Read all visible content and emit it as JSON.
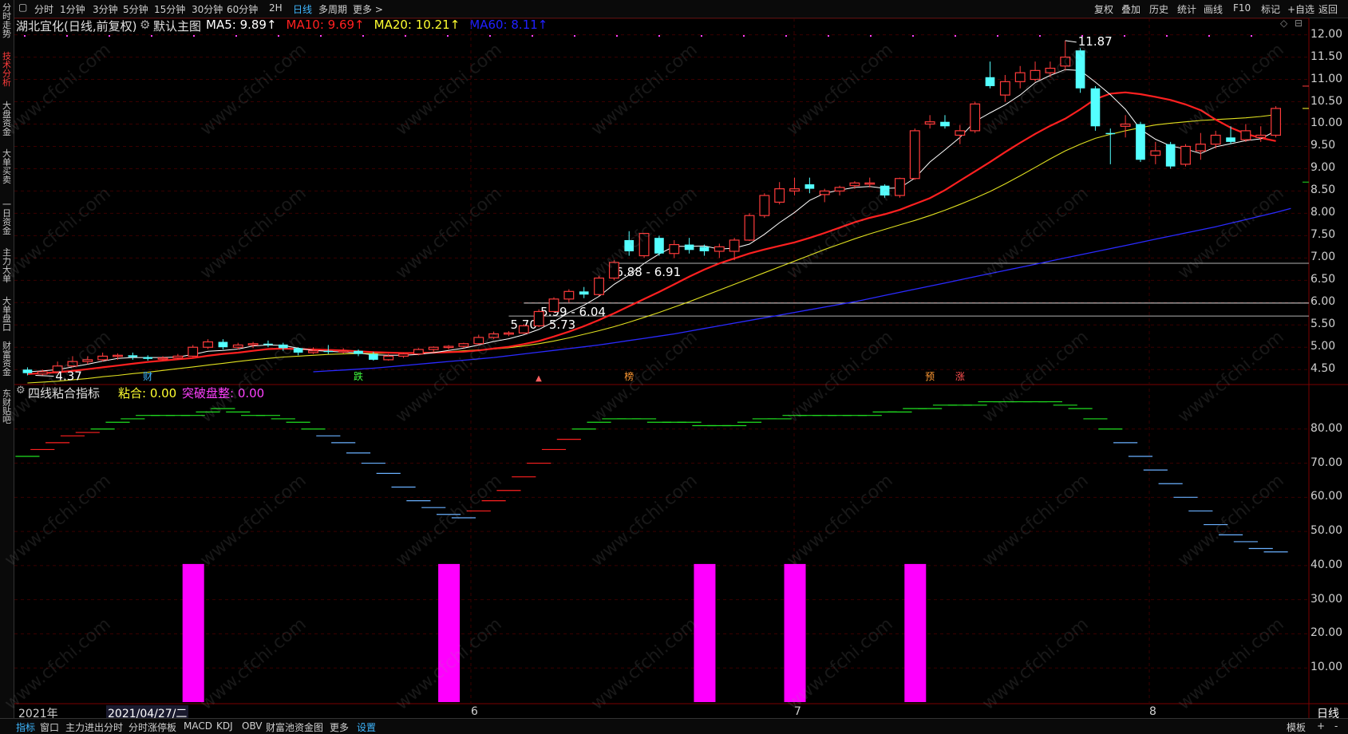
{
  "left_tabs": [
    {
      "label": "分时走势",
      "active": false
    },
    {
      "label": "技术分析",
      "active": true
    },
    {
      "label": "大盘资金",
      "active": false
    },
    {
      "label": "大单买卖",
      "active": false
    },
    {
      "label": "一日资金",
      "active": false
    },
    {
      "label": "主力大单",
      "active": false
    },
    {
      "label": "大单盘口",
      "active": false
    },
    {
      "label": "财富资金",
      "active": false
    },
    {
      "label": "东财贴吧",
      "active": false
    }
  ],
  "periods": [
    "分时",
    "1分钟",
    "3分钟",
    "5分钟",
    "15分钟",
    "30分钟",
    "60分钟",
    "2H",
    "日线",
    "多周期",
    "更多"
  ],
  "active_period": "日线",
  "toolbar": [
    "复权",
    "叠加",
    "历史",
    "统计",
    "画线",
    "F10",
    "标记",
    "+自选",
    "返回"
  ],
  "stock": {
    "title": "湖北宜化(日线,前复权)",
    "main_indicator": "默认主图"
  },
  "ma": [
    {
      "label": "MA5: 9.89",
      "arrow": "↑",
      "color": "#ffffff"
    },
    {
      "label": "MA10: 9.69",
      "arrow": "↑",
      "color": "#ff2020"
    },
    {
      "label": "MA20: 10.21",
      "arrow": "↑",
      "color": "#ffff30"
    },
    {
      "label": "MA60: 8.11",
      "arrow": "↑",
      "color": "#2020ff"
    }
  ],
  "price_axis": [
    "12.00",
    "11.50",
    "11.00",
    "10.50",
    "10.00",
    "9.50",
    "9.00",
    "8.50",
    "8.00",
    "7.50",
    "7.00",
    "6.50",
    "6.00",
    "5.50",
    "5.00",
    "4.50"
  ],
  "price_annotations": {
    "high": "11.87",
    "low": "4.37"
  },
  "ranges": [
    "6.88 - 6.91",
    "5.99 - 6.04",
    "5.70 - 5.73"
  ],
  "event_tags": [
    {
      "label": "财",
      "color": "#3fb7ff"
    },
    {
      "label": "跌",
      "color": "#40ff40"
    },
    {
      "label": "榜",
      "color": "#ff9933"
    },
    {
      "label": "预",
      "color": "#ff9933"
    },
    {
      "label": "涨",
      "color": "#ff5050"
    }
  ],
  "indicator": {
    "name": "四线粘合指标",
    "line1": "粘合: 0.00",
    "line2": "突破盘整: 0.00",
    "axis": [
      "80.00",
      "70.00",
      "60.00",
      "50.00",
      "40.00",
      "30.00",
      "20.00",
      "10.00"
    ]
  },
  "x_axis": {
    "year": "2021年",
    "cursor_date": "2021/04/27/二",
    "months": [
      "6",
      "7",
      "8"
    ],
    "period": "日线"
  },
  "bottom_tabs": [
    "指标",
    "窗口",
    "主力进出分时",
    "分时涨停板",
    "MACD",
    "KDJ",
    "OBV",
    "财富池资金图",
    "更多",
    "设置"
  ],
  "bottom_active": [
    "指标",
    "设置"
  ],
  "bottom_right": [
    "模板",
    "+",
    "-"
  ],
  "watermark": "www.cfchi.com",
  "colors": {
    "up": "#ff3b3b",
    "down": "#54ffff",
    "bg": "#000000",
    "grid": "#3a0000",
    "magenta": "#ff00ff"
  },
  "chart_data": {
    "type": "candlestick",
    "candles": [
      {
        "o": 4.5,
        "c": 4.42,
        "h": 4.55,
        "l": 4.37
      },
      {
        "o": 4.4,
        "c": 4.45,
        "h": 4.5,
        "l": 4.37
      },
      {
        "o": 4.45,
        "c": 4.58,
        "h": 4.68,
        "l": 4.42
      },
      {
        "o": 4.58,
        "c": 4.68,
        "h": 4.8,
        "l": 4.55
      },
      {
        "o": 4.68,
        "c": 4.72,
        "h": 4.8,
        "l": 4.62
      },
      {
        "o": 4.72,
        "c": 4.8,
        "h": 4.88,
        "l": 4.68
      },
      {
        "o": 4.8,
        "c": 4.82,
        "h": 4.86,
        "l": 4.72
      },
      {
        "o": 4.82,
        "c": 4.78,
        "h": 4.88,
        "l": 4.72
      },
      {
        "o": 4.78,
        "c": 4.74,
        "h": 4.82,
        "l": 4.7
      },
      {
        "o": 4.74,
        "c": 4.76,
        "h": 4.8,
        "l": 4.7
      },
      {
        "o": 4.76,
        "c": 4.8,
        "h": 4.85,
        "l": 4.72
      },
      {
        "o": 4.8,
        "c": 5.0,
        "h": 5.05,
        "l": 4.78
      },
      {
        "o": 5.0,
        "c": 5.12,
        "h": 5.18,
        "l": 4.96
      },
      {
        "o": 5.12,
        "c": 5.0,
        "h": 5.18,
        "l": 4.95
      },
      {
        "o": 5.0,
        "c": 5.05,
        "h": 5.1,
        "l": 4.95
      },
      {
        "o": 5.05,
        "c": 5.08,
        "h": 5.12,
        "l": 4.98
      },
      {
        "o": 5.08,
        "c": 5.06,
        "h": 5.15,
        "l": 5.0
      },
      {
        "o": 5.06,
        "c": 4.98,
        "h": 5.1,
        "l": 4.92
      },
      {
        "o": 4.98,
        "c": 4.88,
        "h": 5.0,
        "l": 4.82
      },
      {
        "o": 4.88,
        "c": 4.92,
        "h": 5.0,
        "l": 4.85
      },
      {
        "o": 4.92,
        "c": 4.9,
        "h": 5.05,
        "l": 4.85
      },
      {
        "o": 4.9,
        "c": 4.92,
        "h": 4.98,
        "l": 4.86
      },
      {
        "o": 4.92,
        "c": 4.85,
        "h": 4.95,
        "l": 4.8
      },
      {
        "o": 4.85,
        "c": 4.72,
        "h": 4.9,
        "l": 4.7
      },
      {
        "o": 4.72,
        "c": 4.8,
        "h": 4.85,
        "l": 4.7
      },
      {
        "o": 4.8,
        "c": 4.85,
        "h": 4.88,
        "l": 4.76
      },
      {
        "o": 4.85,
        "c": 4.95,
        "h": 4.98,
        "l": 4.82
      },
      {
        "o": 4.95,
        "c": 5.0,
        "h": 5.02,
        "l": 4.9
      },
      {
        "o": 5.0,
        "c": 5.02,
        "h": 5.05,
        "l": 4.95
      },
      {
        "o": 5.02,
        "c": 5.08,
        "h": 5.1,
        "l": 4.98
      },
      {
        "o": 5.08,
        "c": 5.22,
        "h": 5.28,
        "l": 5.05
      },
      {
        "o": 5.22,
        "c": 5.3,
        "h": 5.35,
        "l": 5.18
      },
      {
        "o": 5.3,
        "c": 5.32,
        "h": 5.36,
        "l": 5.25
      },
      {
        "o": 5.32,
        "c": 5.48,
        "h": 5.52,
        "l": 5.3
      },
      {
        "o": 5.48,
        "c": 5.8,
        "h": 5.85,
        "l": 5.45
      },
      {
        "o": 5.8,
        "c": 6.08,
        "h": 6.12,
        "l": 5.78
      },
      {
        "o": 6.08,
        "c": 6.25,
        "h": 6.3,
        "l": 6.0
      },
      {
        "o": 6.25,
        "c": 6.18,
        "h": 6.35,
        "l": 6.1
      },
      {
        "o": 6.18,
        "c": 6.55,
        "h": 6.6,
        "l": 6.15
      },
      {
        "o": 6.55,
        "c": 6.9,
        "h": 6.95,
        "l": 6.5
      },
      {
        "o": 7.4,
        "c": 7.15,
        "h": 7.6,
        "l": 7.05
      },
      {
        "o": 7.05,
        "c": 7.55,
        "h": 7.55,
        "l": 7.0
      },
      {
        "o": 7.45,
        "c": 7.1,
        "h": 7.5,
        "l": 7.05
      },
      {
        "o": 7.1,
        "c": 7.3,
        "h": 7.4,
        "l": 7.0
      },
      {
        "o": 7.3,
        "c": 7.18,
        "h": 7.45,
        "l": 7.1
      },
      {
        "o": 7.25,
        "c": 7.15,
        "h": 7.3,
        "l": 7.05
      },
      {
        "o": 7.15,
        "c": 7.25,
        "h": 7.32,
        "l": 7.0
      },
      {
        "o": 7.15,
        "c": 7.4,
        "h": 7.45,
        "l": 6.95
      },
      {
        "o": 7.4,
        "c": 7.95,
        "h": 8.0,
        "l": 7.38
      },
      {
        "o": 7.95,
        "c": 8.4,
        "h": 8.45,
        "l": 7.9
      },
      {
        "o": 8.25,
        "c": 8.55,
        "h": 8.7,
        "l": 8.2
      },
      {
        "o": 8.5,
        "c": 8.55,
        "h": 8.8,
        "l": 8.4
      },
      {
        "o": 8.65,
        "c": 8.55,
        "h": 8.8,
        "l": 8.45
      },
      {
        "o": 8.42,
        "c": 8.5,
        "h": 8.55,
        "l": 8.25
      },
      {
        "o": 8.5,
        "c": 8.58,
        "h": 8.62,
        "l": 8.4
      },
      {
        "o": 8.62,
        "c": 8.68,
        "h": 8.72,
        "l": 8.55
      },
      {
        "o": 8.68,
        "c": 8.68,
        "h": 8.8,
        "l": 8.58
      },
      {
        "o": 8.62,
        "c": 8.4,
        "h": 8.65,
        "l": 8.35
      },
      {
        "o": 8.4,
        "c": 8.78,
        "h": 8.8,
        "l": 8.35
      },
      {
        "o": 8.78,
        "c": 9.85,
        "h": 9.9,
        "l": 8.75
      },
      {
        "o": 10.0,
        "c": 10.05,
        "h": 10.2,
        "l": 9.9
      },
      {
        "o": 10.05,
        "c": 9.95,
        "h": 10.2,
        "l": 9.9
      },
      {
        "o": 9.75,
        "c": 9.85,
        "h": 9.98,
        "l": 9.55
      },
      {
        "o": 9.85,
        "c": 10.45,
        "h": 10.5,
        "l": 9.8
      },
      {
        "o": 11.05,
        "c": 10.85,
        "h": 11.4,
        "l": 10.8
      },
      {
        "o": 10.65,
        "c": 10.95,
        "h": 11.1,
        "l": 10.5
      },
      {
        "o": 10.95,
        "c": 11.15,
        "h": 11.3,
        "l": 10.8
      },
      {
        "o": 11.0,
        "c": 11.2,
        "h": 11.4,
        "l": 10.95
      },
      {
        "o": 11.15,
        "c": 11.25,
        "h": 11.4,
        "l": 11.05
      },
      {
        "o": 11.3,
        "c": 11.5,
        "h": 11.87,
        "l": 11.2
      },
      {
        "o": 11.65,
        "c": 10.8,
        "h": 11.7,
        "l": 10.7
      },
      {
        "o": 10.8,
        "c": 9.95,
        "h": 10.85,
        "l": 9.85
      },
      {
        "o": 9.8,
        "c": 9.78,
        "h": 9.9,
        "l": 9.1
      },
      {
        "o": 9.95,
        "c": 10.0,
        "h": 10.2,
        "l": 9.7
      },
      {
        "o": 10.0,
        "c": 9.2,
        "h": 10.05,
        "l": 9.15
      },
      {
        "o": 9.3,
        "c": 9.4,
        "h": 9.6,
        "l": 9.1
      },
      {
        "o": 9.55,
        "c": 9.05,
        "h": 9.6,
        "l": 9.0
      },
      {
        "o": 9.1,
        "c": 9.5,
        "h": 9.55,
        "l": 9.05
      },
      {
        "o": 9.4,
        "c": 9.55,
        "h": 9.8,
        "l": 9.2
      },
      {
        "o": 9.55,
        "c": 9.75,
        "h": 9.85,
        "l": 9.45
      },
      {
        "o": 9.7,
        "c": 9.6,
        "h": 9.95,
        "l": 9.55
      },
      {
        "o": 9.65,
        "c": 9.85,
        "h": 10.0,
        "l": 9.6
      },
      {
        "o": 9.7,
        "c": 9.75,
        "h": 9.95,
        "l": 9.6
      },
      {
        "o": 9.75,
        "c": 10.35,
        "h": 10.4,
        "l": 9.7
      }
    ],
    "ma5": [
      4.45,
      4.47,
      4.5,
      4.56,
      4.62,
      4.69,
      4.75,
      4.77,
      4.77,
      4.77,
      4.78,
      4.84,
      4.91,
      4.93,
      4.96,
      5.03,
      5.05,
      5.04,
      4.98,
      4.93,
      4.91,
      4.89,
      4.87,
      4.83,
      4.82,
      4.82,
      4.84,
      4.88,
      4.93,
      4.98,
      5.05,
      5.13,
      5.19,
      5.28,
      5.4,
      5.57,
      5.78,
      5.94,
      6.14,
      6.41,
      6.62,
      6.88,
      7.09,
      7.26,
      7.26,
      7.27,
      7.2,
      7.22,
      7.31,
      7.53,
      7.79,
      8.02,
      8.29,
      8.45,
      8.52,
      8.58,
      8.6,
      8.56,
      8.57,
      8.79,
      9.15,
      9.42,
      9.7,
      10.06,
      10.25,
      10.43,
      10.65,
      10.93,
      11.09,
      11.22,
      11.2,
      10.94,
      10.66,
      10.33,
      9.88,
      9.66,
      9.51,
      9.44,
      9.34,
      9.49,
      9.56,
      9.63,
      9.67,
      9.85
    ],
    "ma10": [
      4.4,
      4.42,
      4.44,
      4.47,
      4.51,
      4.55,
      4.59,
      4.63,
      4.67,
      4.7,
      4.73,
      4.76,
      4.81,
      4.85,
      4.88,
      4.92,
      4.96,
      4.97,
      4.96,
      4.95,
      4.94,
      4.93,
      4.91,
      4.89,
      4.88,
      4.87,
      4.87,
      4.88,
      4.89,
      4.9,
      4.93,
      4.97,
      5.01,
      5.07,
      5.14,
      5.24,
      5.35,
      5.47,
      5.61,
      5.76,
      5.92,
      6.08,
      6.24,
      6.41,
      6.58,
      6.74,
      6.88,
      6.99,
      7.1,
      7.19,
      7.27,
      7.35,
      7.45,
      7.56,
      7.68,
      7.8,
      7.9,
      7.98,
      8.08,
      8.21,
      8.34,
      8.52,
      8.73,
      8.94,
      9.15,
      9.37,
      9.58,
      9.78,
      9.96,
      10.12,
      10.33,
      10.56,
      10.68,
      10.71,
      10.67,
      10.61,
      10.54,
      10.44,
      10.31,
      10.1,
      9.92,
      9.78,
      9.69,
      9.62
    ],
    "ma20": [
      4.2,
      4.22,
      4.24,
      4.27,
      4.3,
      4.34,
      4.37,
      4.41,
      4.44,
      4.48,
      4.52,
      4.56,
      4.6,
      4.64,
      4.68,
      4.72,
      4.75,
      4.78,
      4.8,
      4.82,
      4.84,
      4.85,
      4.86,
      4.86,
      4.87,
      4.87,
      4.88,
      4.89,
      4.9,
      4.92,
      4.94,
      4.96,
      4.99,
      5.03,
      5.08,
      5.14,
      5.21,
      5.29,
      5.37,
      5.46,
      5.56,
      5.67,
      5.78,
      5.9,
      6.02,
      6.15,
      6.28,
      6.41,
      6.54,
      6.67,
      6.8,
      6.93,
      7.06,
      7.19,
      7.31,
      7.43,
      7.54,
      7.64,
      7.74,
      7.84,
      7.95,
      8.07,
      8.2,
      8.34,
      8.49,
      8.66,
      8.84,
      9.03,
      9.22,
      9.4,
      9.55,
      9.68,
      9.77,
      9.85,
      9.92,
      9.98,
      10.02,
      10.05,
      10.08,
      10.1,
      10.12,
      10.14,
      10.17,
      10.21
    ],
    "ma60": [
      null,
      null,
      null,
      null,
      null,
      null,
      null,
      null,
      null,
      null,
      null,
      null,
      null,
      null,
      null,
      null,
      null,
      null,
      null,
      4.45,
      4.47,
      4.49,
      4.51,
      4.53,
      4.56,
      4.59,
      4.62,
      4.65,
      4.68,
      4.71,
      4.74,
      4.77,
      4.81,
      4.85,
      4.89,
      4.93,
      4.97,
      5.01,
      5.05,
      5.1,
      5.15,
      5.2,
      5.25,
      5.3,
      5.36,
      5.42,
      5.48,
      5.54,
      5.6,
      5.66,
      5.72,
      5.78,
      5.84,
      5.9,
      5.96,
      6.02,
      6.09,
      6.16,
      6.23,
      6.3,
      6.37,
      6.44,
      6.51,
      6.58,
      6.65,
      6.72,
      6.79,
      6.86,
      6.93,
      7.0,
      7.07,
      7.14,
      7.21,
      7.28,
      7.35,
      7.42,
      7.49,
      7.56,
      7.63,
      7.7,
      7.78,
      7.86,
      7.94,
      8.02,
      8.11
    ],
    "indicator_values": [
      72,
      74,
      76,
      78,
      79,
      80,
      82,
      83,
      84,
      84,
      84,
      84,
      85,
      86,
      85,
      84,
      84,
      83,
      82,
      80,
      78,
      76,
      73,
      70,
      67,
      63,
      59,
      57,
      55,
      54,
      56,
      59,
      62,
      66,
      70,
      74,
      77,
      80,
      82,
      83,
      83,
      83,
      82,
      82,
      82,
      81,
      81,
      81,
      82,
      83,
      83,
      84,
      84,
      84,
      84,
      84,
      84,
      85,
      85,
      86,
      86,
      87,
      87,
      87,
      88,
      88,
      88,
      88,
      88,
      87,
      86,
      83,
      80,
      76,
      72,
      68,
      64,
      60,
      56,
      52,
      49,
      47,
      45,
      44
    ],
    "pillar_indices": [
      11,
      28,
      45,
      51,
      59
    ],
    "price_range": [
      4.2,
      12.1
    ],
    "indicator_range": [
      0,
      90
    ]
  }
}
